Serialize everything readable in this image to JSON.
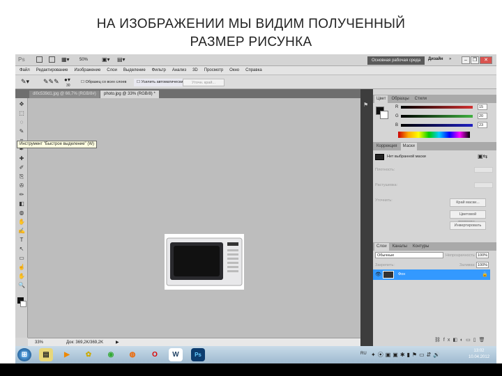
{
  "slide": {
    "title_line1": "НА ИЗОБРАЖЕНИИ МЫ ВИДИМ ПОЛУЧЕННЫЙ",
    "title_line2": "РАЗМЕР РИСУНКА"
  },
  "appbar": {
    "logo": "Ps",
    "zoom": "50%",
    "workspace": "Основная рабочая среда",
    "design": "Дизайн",
    "more": "»"
  },
  "menu": [
    "Файл",
    "Редактирование",
    "Изображение",
    "Слои",
    "Выделение",
    "Фильтр",
    "Анализ",
    "3D",
    "Просмотр",
    "Окно",
    "Справка"
  ],
  "options": {
    "brush_size": "30",
    "sample_all": "Образец со всех слоев",
    "auto_enhance": "Усилить автоматически",
    "refine": "Уточн. край..."
  },
  "tabs": [
    "dl0c539d1.jpg @ 66,7% (RGB/8#)",
    "photo.jpg @ 33% (RGB/8) *"
  ],
  "tooltip": "Инструмент \"Быстрое выделение\" (W)",
  "status": {
    "zoom": "33%",
    "doc": "Док: 369,2K/369,2K"
  },
  "color_panel": {
    "tabs": [
      "Цвет",
      "Образцы",
      "Стили"
    ],
    "channels": [
      {
        "label": "R",
        "value": "15",
        "color": "#d03030"
      },
      {
        "label": "G",
        "value": "20",
        "color": "#40b040"
      },
      {
        "label": "B",
        "value": "23",
        "color": "#2020c0"
      }
    ]
  },
  "masks_panel": {
    "tabs": [
      "Коррекция",
      "Маски"
    ],
    "mask_label": "Нет выбранной маски",
    "density": "Плотность:",
    "feather": "Растушевка:",
    "refine": "Уточнить:",
    "buttons": [
      "Край маски...",
      "Цветовой диапазон...",
      "Инвертировать"
    ]
  },
  "layers_panel": {
    "tabs": [
      "Слои",
      "Каналы",
      "Контуры"
    ],
    "blend": "Обычные",
    "opacity_label": "Непрозрачность:",
    "opacity": "100%",
    "lock_label": "Закрепить:",
    "fill_label": "Заливка:",
    "fill": "100%",
    "layer_name": "Фон",
    "accent": "#3399ff"
  },
  "taskbar": {
    "time": "13:02",
    "date": "10.04.2012",
    "lang": "RU"
  }
}
